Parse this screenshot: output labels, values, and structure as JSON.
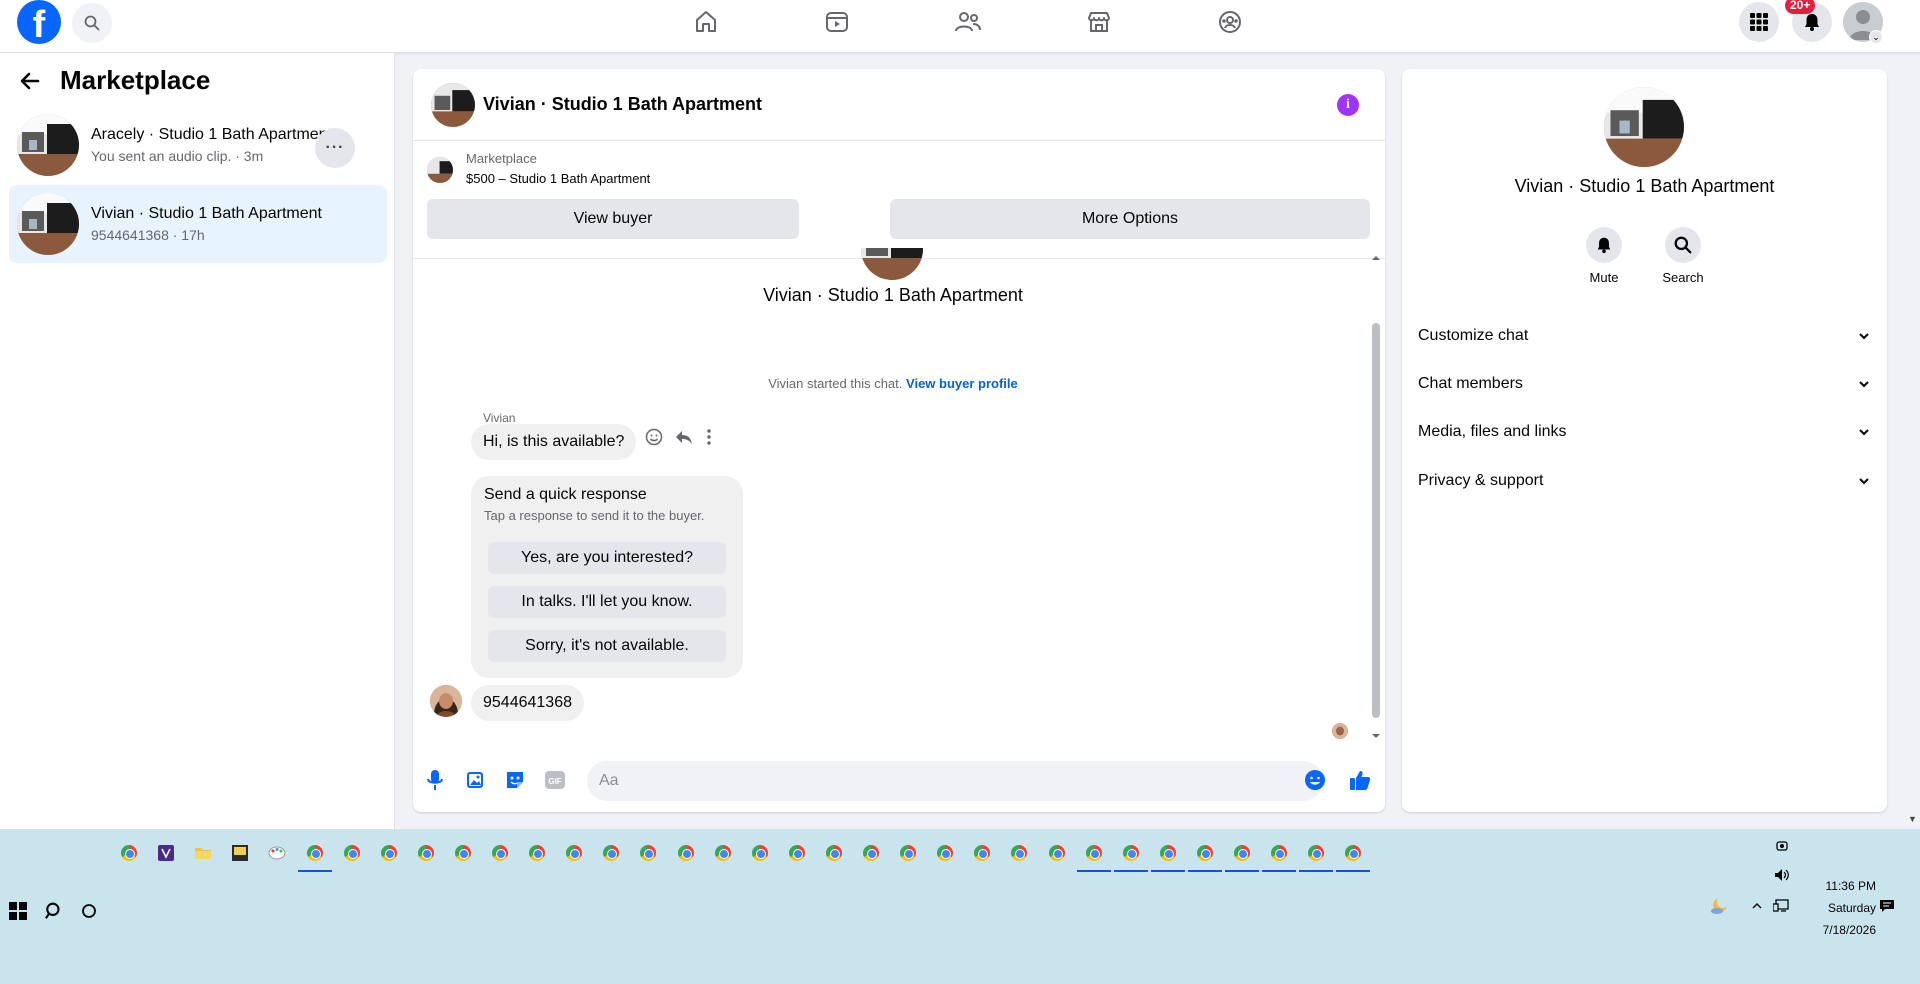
{
  "topbar": {
    "logo_letter": "f",
    "notification_badge": "20+",
    "nav_icons": [
      "home-icon",
      "video-icon",
      "friends-icon",
      "marketplace-icon",
      "groups-icon"
    ]
  },
  "left_panel": {
    "title": "Marketplace",
    "conversations": [
      {
        "name": "Aracely · Studio 1 Bath Apartment",
        "subtitle": "You sent an audio clip. · 3m",
        "active": false
      },
      {
        "name": "Vivian · Studio 1 Bath Apartment",
        "subtitle": "9544641368 · 17h",
        "active": true
      }
    ],
    "more_label": "···"
  },
  "chat": {
    "title": "Vivian · Studio 1 Bath Apartment",
    "info_icon": "i",
    "marketplace_label": "Marketplace",
    "listing": "$500 – Studio 1 Bath Apartment",
    "view_buyer_label": "View buyer",
    "more_options_label": "More Options",
    "center_name": "Vivian · Studio 1 Bath Apartment",
    "started_text": "Vivian started this chat.",
    "view_profile_link": "View buyer profile",
    "sender_name": "Vivian",
    "first_message": "Hi, is this available?",
    "quick_response": {
      "title": "Send a quick response",
      "subtitle": "Tap a response to send it to the buyer.",
      "options": [
        "Yes, are you interested?",
        "In talks. I'll let you know.",
        "Sorry, it's not available."
      ]
    },
    "second_message": "9544641368",
    "composer_placeholder": "Aa"
  },
  "right_panel": {
    "name": "Vivian · Studio 1 Bath Apartment",
    "actions": [
      {
        "label": "Mute",
        "icon": "bell-icon"
      },
      {
        "label": "Search",
        "icon": "search-icon"
      }
    ],
    "sections": [
      "Customize chat",
      "Chat members",
      "Media, files and links",
      "Privacy & support"
    ]
  },
  "taskbar": {
    "time": "11:36 PM",
    "day": "Saturday",
    "date": "7/18/2026"
  },
  "colors": {
    "brand_blue": "#0866ff",
    "link_blue": "#0064d1",
    "accent_purple": "#a033ff",
    "badge_red": "#e41e3f",
    "active_row": "#e7f3ff",
    "taskbar": "#c9e4ec"
  }
}
